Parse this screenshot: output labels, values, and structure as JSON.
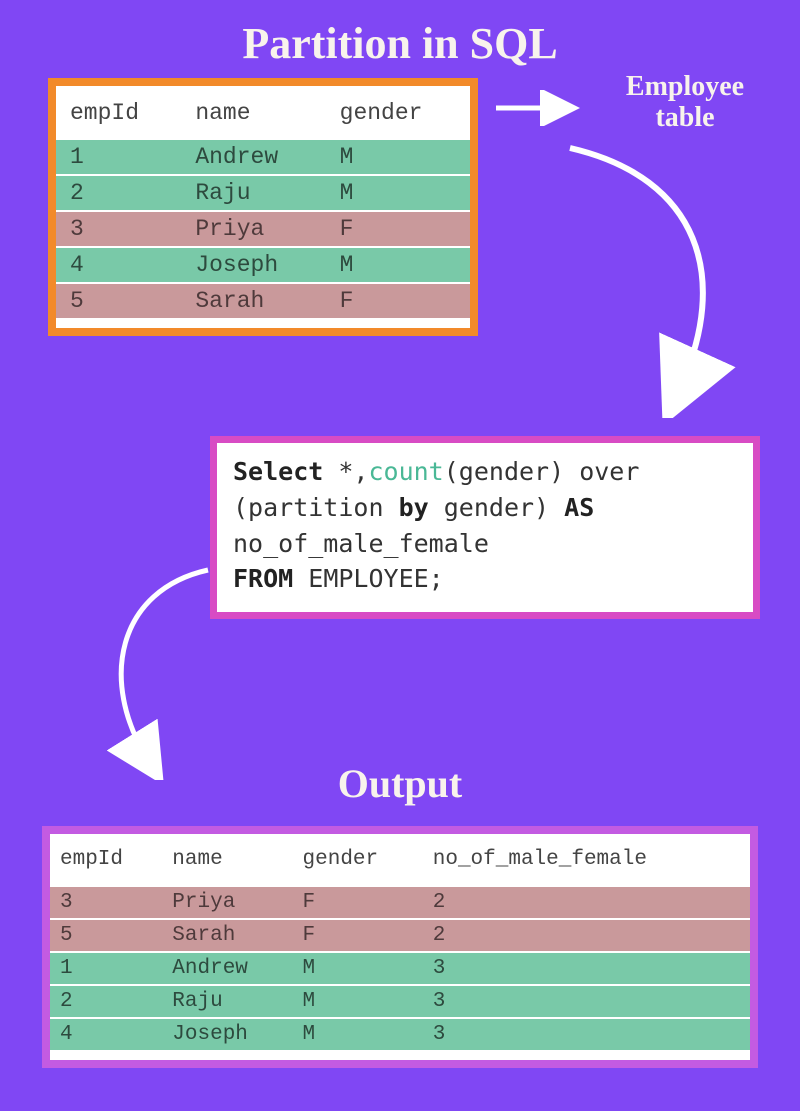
{
  "title": "Partition in SQL",
  "employee_label_line1": "Employee",
  "employee_label_line2": "table",
  "output_title": "Output",
  "colors": {
    "background": "#8047F4",
    "table1_border": "#F28A2A",
    "table2_border": "#C35BE2",
    "sql_border": "#D84BC4",
    "row_green": "#79C9A8",
    "row_pink": "#C9999B",
    "arrow": "#FFFFFF",
    "title_text": "#F8F3EC"
  },
  "employee_table": {
    "headers": [
      "empId",
      "name",
      "gender"
    ],
    "rows": [
      {
        "empId": "1",
        "name": "Andrew",
        "gender": "M",
        "color": "green"
      },
      {
        "empId": "2",
        "name": "Raju",
        "gender": "M",
        "color": "green"
      },
      {
        "empId": "3",
        "name": "Priya",
        "gender": "F",
        "color": "pink"
      },
      {
        "empId": "4",
        "name": "Joseph",
        "gender": "M",
        "color": "green"
      },
      {
        "empId": "5",
        "name": "Sarah",
        "gender": "F",
        "color": "pink"
      }
    ]
  },
  "sql": {
    "tokens": [
      {
        "t": "Select ",
        "c": "kw"
      },
      {
        "t": "*,",
        "c": ""
      },
      {
        "t": "count",
        "c": "fn"
      },
      {
        "t": "(gender) over",
        "c": ""
      },
      {
        "t": "\n",
        "c": "br"
      },
      {
        "t": "(partition ",
        "c": ""
      },
      {
        "t": "by",
        "c": "kw"
      },
      {
        "t": " gender) ",
        "c": ""
      },
      {
        "t": "AS",
        "c": "kw"
      },
      {
        "t": "\n",
        "c": "br"
      },
      {
        "t": "no_of_male_female",
        "c": ""
      },
      {
        "t": "\n",
        "c": "br"
      },
      {
        "t": "FROM",
        "c": "kw"
      },
      {
        "t": " EMPLOYEE;",
        "c": ""
      }
    ],
    "plain": "Select *,count(gender) over (partition by gender) AS no_of_male_female FROM EMPLOYEE;"
  },
  "output_table": {
    "headers": [
      "empId",
      "name",
      "gender",
      "no_of_male_female"
    ],
    "rows": [
      {
        "empId": "3",
        "name": "Priya",
        "gender": "F",
        "no_of_male_female": "2",
        "color": "pink"
      },
      {
        "empId": "5",
        "name": "Sarah",
        "gender": "F",
        "no_of_male_female": "2",
        "color": "pink"
      },
      {
        "empId": "1",
        "name": "Andrew",
        "gender": "M",
        "no_of_male_female": "3",
        "color": "green"
      },
      {
        "empId": "2",
        "name": "Raju",
        "gender": "M",
        "no_of_male_female": "3",
        "color": "green"
      },
      {
        "empId": "4",
        "name": "Joseph",
        "gender": "M",
        "no_of_male_female": "3",
        "color": "green"
      }
    ]
  }
}
